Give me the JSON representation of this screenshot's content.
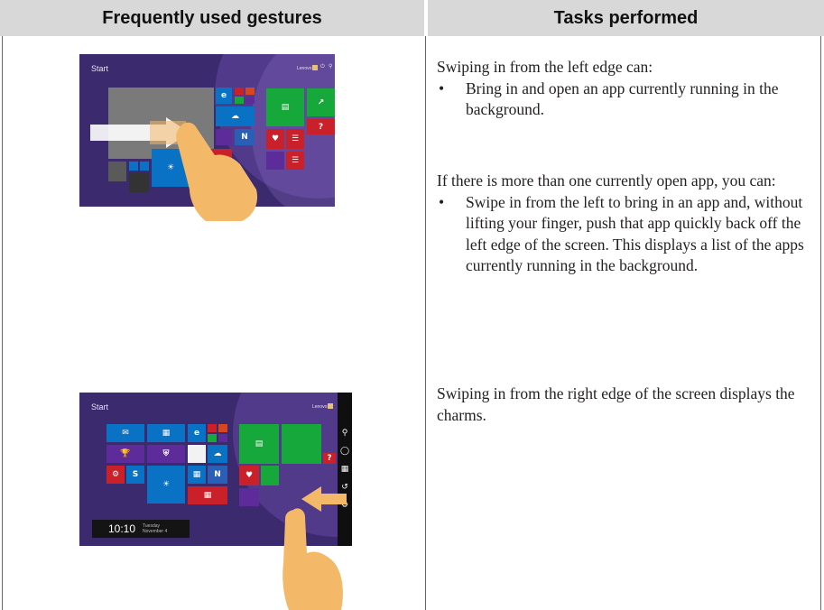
{
  "header": {
    "left": "Frequently used gestures",
    "right": "Tasks performed"
  },
  "screens": {
    "start_label": "Start",
    "user_label": "Lenovo",
    "clock_time": "10:10",
    "clock_day": "Tuesday",
    "clock_date": "November 4"
  },
  "icons": [
    "touch-hand-icon",
    "swipe-arrow-icon",
    "search-icon",
    "share-icon",
    "start-icon",
    "devices-icon",
    "settings-icon"
  ],
  "colors": {
    "header_bg": "#d8d8d8",
    "start_bg": "#3b2a6e",
    "tile_blue": "#0a72c4",
    "tile_green": "#16a83a",
    "tile_red": "#c9202a",
    "tile_orange": "#d8461f",
    "tile_purple": "#5e2b9a",
    "hand": "#f3b868"
  },
  "tasks": {
    "left_edge": {
      "intro": "Swiping in from the left edge can:",
      "bullets": [
        "Bring in and open an app currently running in the background."
      ]
    },
    "multiple_apps": {
      "intro": "If there is more than one currently open app, you can:",
      "bullets": [
        "Swipe in from the left to bring in an app and, without lifting your finger, push that app quickly back off the left edge of the screen. This displays a list of the apps currently running in the background."
      ]
    },
    "right_edge": {
      "text": "Swiping in from the right edge of the screen displays the charms."
    }
  }
}
